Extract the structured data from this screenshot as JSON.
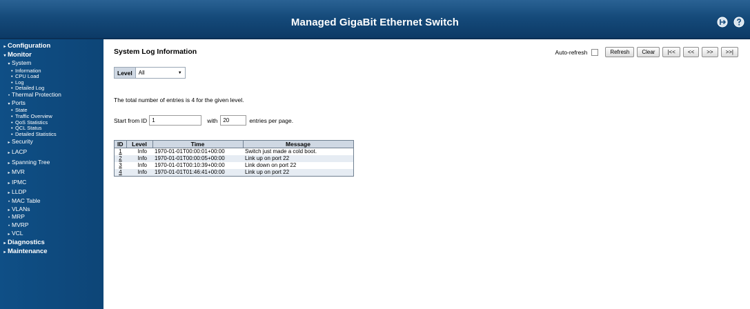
{
  "header": {
    "title": "Managed GigaBit Ethernet Switch",
    "icons": [
      "logout-icon",
      "help-icon"
    ]
  },
  "sidebar": {
    "items": [
      {
        "label": "Configuration",
        "level": 0,
        "arrow": "▸"
      },
      {
        "label": "Monitor",
        "level": 0,
        "arrow": "▾"
      },
      {
        "label": "System",
        "level": 1,
        "arrow": "▾"
      },
      {
        "label": "Information",
        "level": 2
      },
      {
        "label": "CPU Load",
        "level": 2
      },
      {
        "label": "Log",
        "level": 2
      },
      {
        "label": "Detailed Log",
        "level": 2
      },
      {
        "label": "Thermal Protection",
        "level": 1,
        "arrow": "•"
      },
      {
        "label": "Ports",
        "level": 1,
        "arrow": "▾"
      },
      {
        "label": "State",
        "level": 2
      },
      {
        "label": "Traffic Overview",
        "level": 2
      },
      {
        "label": "QoS Statistics",
        "level": 2
      },
      {
        "label": "QCL Status",
        "level": 2
      },
      {
        "label": "Detailed Statistics",
        "level": 2
      },
      {
        "label": "Security",
        "level": 1,
        "arrow": "▸"
      },
      {
        "label": "LACP",
        "level": 1,
        "arrow": "▸"
      },
      {
        "label": "Spanning Tree",
        "level": 1,
        "arrow": "▸"
      },
      {
        "label": "MVR",
        "level": 1,
        "arrow": "▸"
      },
      {
        "label": "IPMC",
        "level": 1,
        "arrow": "▸"
      },
      {
        "label": "LLDP",
        "level": 1,
        "arrow": "▸"
      },
      {
        "label": "MAC Table",
        "level": 1,
        "arrow": "•"
      },
      {
        "label": "VLANs",
        "level": 1,
        "arrow": "▸"
      },
      {
        "label": "MRP",
        "level": 1,
        "arrow": "•"
      },
      {
        "label": "MVRP",
        "level": 1,
        "arrow": "•"
      },
      {
        "label": "VCL",
        "level": 1,
        "arrow": "▸"
      },
      {
        "label": "Diagnostics",
        "level": 0,
        "arrow": "▸"
      },
      {
        "label": "Maintenance",
        "level": 0,
        "arrow": "▸"
      }
    ]
  },
  "main": {
    "title": "System Log Information",
    "toolbar": {
      "auto_refresh_label": "Auto-refresh",
      "auto_refresh_checked": false,
      "refresh_label": "Refresh",
      "clear_label": "Clear",
      "first_label": "|<<",
      "prev_label": "<<",
      "next_label": ">>",
      "last_label": ">>|"
    },
    "level_filter": {
      "label": "Level",
      "selected": "All"
    },
    "summary_text": "The total number of entries is 4 for the given level.",
    "paging": {
      "start_label": "Start from ID",
      "start_value": "1",
      "with_label": "with",
      "with_value": "20",
      "per_page_label": "entries per page."
    },
    "table": {
      "headers": [
        "ID",
        "Level",
        "Time",
        "Message"
      ],
      "rows": [
        {
          "id": "1",
          "level": "Info",
          "time": "1970-01-01T00:00:01+00:00",
          "message": "Switch just made a cold boot."
        },
        {
          "id": "2",
          "level": "Info",
          "time": "1970-01-01T00:00:05+00:00",
          "message": "Link up on port 22"
        },
        {
          "id": "3",
          "level": "Info",
          "time": "1970-01-01T00:10:39+00:00",
          "message": "Link down on port 22"
        },
        {
          "id": "4",
          "level": "Info",
          "time": "1970-01-01T01:46:41+00:00",
          "message": "Link up on port 22"
        }
      ]
    }
  }
}
